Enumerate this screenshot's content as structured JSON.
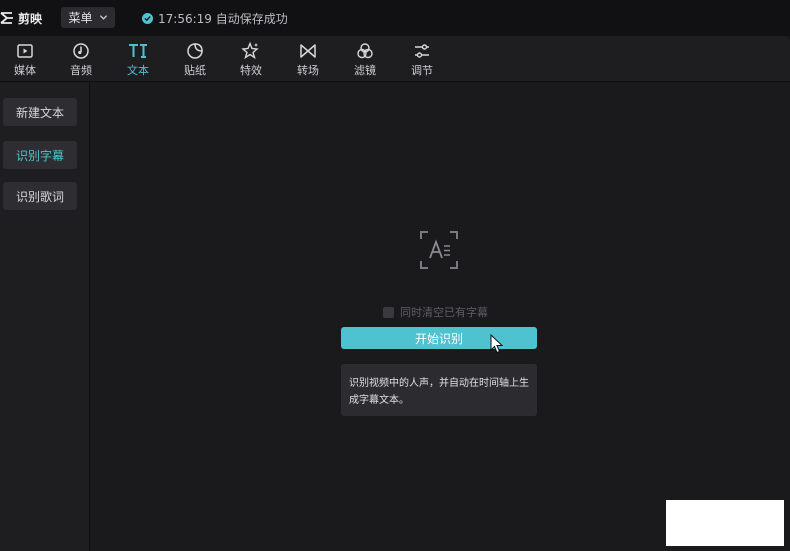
{
  "app": {
    "name": "剪映",
    "menu_label": "菜单",
    "save_status": "17:56:19 自动保存成功"
  },
  "toolbar": {
    "items": [
      {
        "label": "媒体",
        "icon": "media-icon"
      },
      {
        "label": "音频",
        "icon": "audio-icon"
      },
      {
        "label": "文本",
        "icon": "text-icon",
        "active": true
      },
      {
        "label": "贴纸",
        "icon": "sticker-icon"
      },
      {
        "label": "特效",
        "icon": "effects-icon"
      },
      {
        "label": "转场",
        "icon": "transition-icon"
      },
      {
        "label": "滤镜",
        "icon": "filter-icon"
      },
      {
        "label": "调节",
        "icon": "adjust-icon"
      }
    ]
  },
  "sidebar": {
    "items": [
      {
        "label": "新建文本"
      },
      {
        "label": "识别字幕",
        "active": true
      },
      {
        "label": "识别歌词"
      }
    ]
  },
  "main": {
    "clear_checkbox_label": "同时清空已有字幕",
    "start_button_label": "开始识别",
    "tip_text": "识别视频中的人声，并自动在时间轴上生成字幕文本。"
  },
  "colors": {
    "accent": "#4ec2cf",
    "background": "#1a1a1c",
    "panel": "#1e1e21"
  }
}
